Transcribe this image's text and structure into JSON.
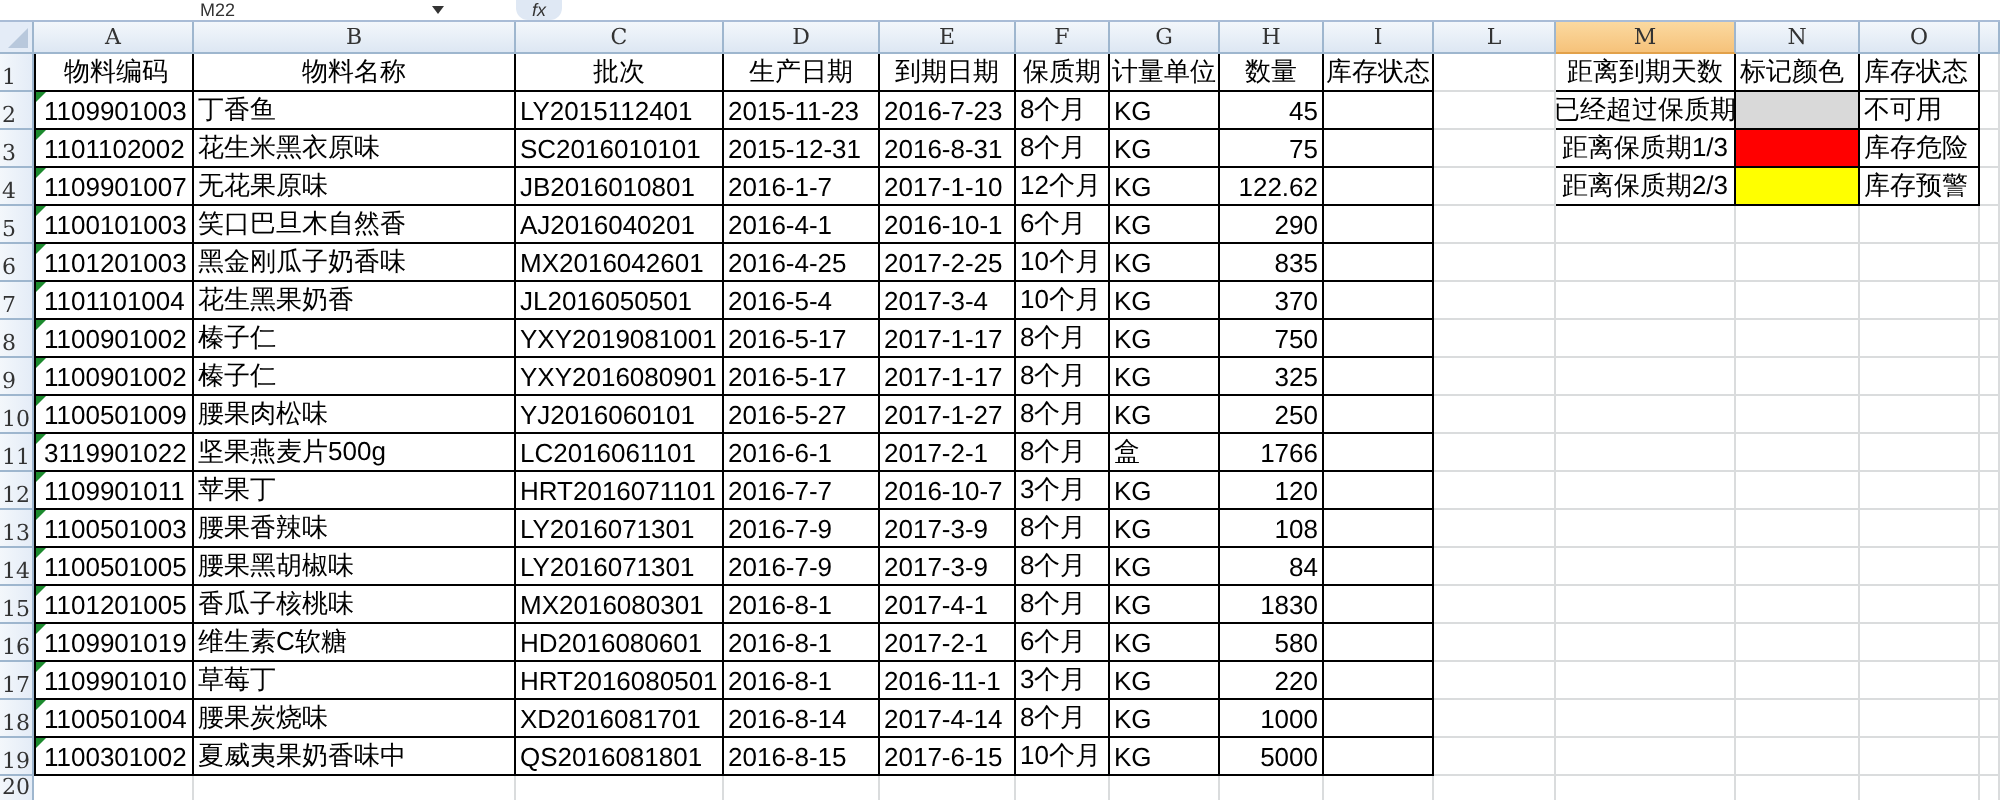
{
  "formula_bar": {
    "name_box": "M22",
    "function_button": "fx"
  },
  "columns": [
    {
      "label": "A",
      "selected": false
    },
    {
      "label": "B",
      "selected": false
    },
    {
      "label": "C",
      "selected": false
    },
    {
      "label": "D",
      "selected": false
    },
    {
      "label": "E",
      "selected": false
    },
    {
      "label": "F",
      "selected": false
    },
    {
      "label": "G",
      "selected": false
    },
    {
      "label": "H",
      "selected": false
    },
    {
      "label": "I",
      "selected": false
    },
    {
      "label": "L",
      "selected": false
    },
    {
      "label": "M",
      "selected": true
    },
    {
      "label": "N",
      "selected": false
    },
    {
      "label": "O",
      "selected": false
    }
  ],
  "rows": [
    {
      "number": "1",
      "text_number": false,
      "cells": [
        "物料编码",
        "物料名称",
        "批次",
        "生产日期",
        "到期日期",
        "保质期",
        "计量单位",
        "数量",
        "库存状态"
      ]
    },
    {
      "number": "2",
      "text_number": true,
      "cells": [
        "1109901003",
        "丁香鱼",
        "LY2015112401",
        "2015-11-23",
        "2016-7-23",
        "8个月",
        "KG",
        "45",
        ""
      ]
    },
    {
      "number": "3",
      "text_number": true,
      "cells": [
        "1101102002",
        "花生米黑衣原味",
        "SC2016010101",
        "2015-12-31",
        "2016-8-31",
        "8个月",
        "KG",
        "75",
        ""
      ]
    },
    {
      "number": "4",
      "text_number": true,
      "cells": [
        "1109901007",
        "无花果原味",
        "JB2016010801",
        "2016-1-7",
        "2017-1-10",
        "12个月",
        "KG",
        "122.62",
        ""
      ]
    },
    {
      "number": "5",
      "text_number": true,
      "cells": [
        "1100101003",
        "笑口巴旦木自然香",
        "AJ2016040201",
        "2016-4-1",
        "2016-10-1",
        "6个月",
        "KG",
        "290",
        ""
      ]
    },
    {
      "number": "6",
      "text_number": true,
      "cells": [
        "1101201003",
        "黑金刚瓜子奶香味",
        "MX2016042601",
        "2016-4-25",
        "2017-2-25",
        "10个月",
        "KG",
        "835",
        ""
      ]
    },
    {
      "number": "7",
      "text_number": true,
      "cells": [
        "1101101004",
        "花生黑果奶香",
        "JL2016050501",
        "2016-5-4",
        "2017-3-4",
        "10个月",
        "KG",
        "370",
        ""
      ]
    },
    {
      "number": "8",
      "text_number": true,
      "cells": [
        "1100901002",
        "榛子仁",
        "YXY2019081001",
        "2016-5-17",
        "2017-1-17",
        "8个月",
        "KG",
        "750",
        ""
      ]
    },
    {
      "number": "9",
      "text_number": true,
      "cells": [
        "1100901002",
        "榛子仁",
        "YXY2016080901",
        "2016-5-17",
        "2017-1-17",
        "8个月",
        "KG",
        "325",
        ""
      ]
    },
    {
      "number": "10",
      "text_number": true,
      "cells": [
        "1100501009",
        "腰果肉松味",
        "YJ2016060101",
        "2016-5-27",
        "2017-1-27",
        "8个月",
        "KG",
        "250",
        ""
      ]
    },
    {
      "number": "11",
      "text_number": true,
      "cells": [
        "3119901022",
        "坚果燕麦片500g",
        "LC2016061101",
        "2016-6-1",
        "2017-2-1",
        "8个月",
        "盒",
        "1766",
        ""
      ]
    },
    {
      "number": "12",
      "text_number": true,
      "cells": [
        "1109901011",
        "苹果丁",
        "HRT2016071101",
        "2016-7-7",
        "2016-10-7",
        "3个月",
        "KG",
        "120",
        ""
      ]
    },
    {
      "number": "13",
      "text_number": true,
      "cells": [
        "1100501003",
        "腰果香辣味",
        "LY2016071301",
        "2016-7-9",
        "2017-3-9",
        "8个月",
        "KG",
        "108",
        ""
      ]
    },
    {
      "number": "14",
      "text_number": true,
      "cells": [
        "1100501005",
        "腰果黑胡椒味",
        "LY2016071301",
        "2016-7-9",
        "2017-3-9",
        "8个月",
        "KG",
        "84",
        ""
      ]
    },
    {
      "number": "15",
      "text_number": true,
      "cells": [
        "1101201005",
        "香瓜子核桃味",
        "MX2016080301",
        "2016-8-1",
        "2017-4-1",
        "8个月",
        "KG",
        "1830",
        ""
      ]
    },
    {
      "number": "16",
      "text_number": true,
      "cells": [
        "1109901019",
        "维生素C软糖",
        "HD2016080601",
        "2016-8-1",
        "2017-2-1",
        "6个月",
        "KG",
        "580",
        ""
      ]
    },
    {
      "number": "17",
      "text_number": true,
      "cells": [
        "1109901010",
        "草莓丁",
        "HRT2016080501",
        "2016-8-1",
        "2016-11-1",
        "3个月",
        "KG",
        "220",
        ""
      ]
    },
    {
      "number": "18",
      "text_number": true,
      "cells": [
        "1100501004",
        "腰果炭烧味",
        "XD2016081701",
        "2016-8-14",
        "2017-4-14",
        "8个月",
        "KG",
        "1000",
        ""
      ]
    },
    {
      "number": "19",
      "text_number": true,
      "cells": [
        "1100301002",
        "夏威夷果奶香味中",
        "QS2016081801",
        "2016-8-15",
        "2017-6-15",
        "10个月",
        "KG",
        "5000",
        ""
      ]
    }
  ],
  "extra_rows": [
    "20"
  ],
  "legend": {
    "header": [
      "距离到期天数",
      "标记颜色",
      "库存状态"
    ],
    "items": [
      {
        "label": "已经超过保质期",
        "color": "#d9d9d9",
        "status": "不可用"
      },
      {
        "label": "距离保质期1/3",
        "color": "#ff0000",
        "status": "库存危险"
      },
      {
        "label": "距离保质期2/3",
        "color": "#ffff00",
        "status": "库存预警"
      }
    ]
  }
}
